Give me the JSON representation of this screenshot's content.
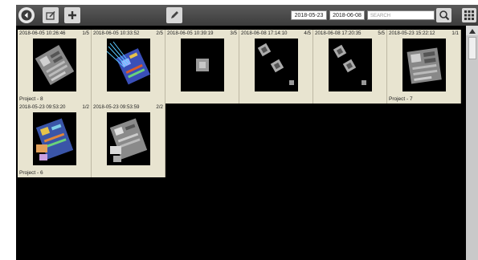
{
  "toolbar": {
    "date_from": "2018-05-23",
    "date_to": "2018-06-08",
    "search_placeholder": "SEARCH"
  },
  "tiles": [
    {
      "timestamp": "2018-06-05 10:26:46",
      "count": "1/5",
      "project": "Project - 8"
    },
    {
      "timestamp": "2018-06-05 10:33:52",
      "count": "2/5",
      "project": ""
    },
    {
      "timestamp": "2018-06-05 10:39:19",
      "count": "3/5",
      "project": ""
    },
    {
      "timestamp": "2018-06-08 17:14:10",
      "count": "4/5",
      "project": ""
    },
    {
      "timestamp": "2018-06-08 17:20:35",
      "count": "5/5",
      "project": ""
    },
    {
      "timestamp": "2018-05-23 15:22:12",
      "count": "1/1",
      "project": "Project - 7"
    },
    {
      "timestamp": "2018-05-23 09:53:20",
      "count": "1/2",
      "project": "Project - 6"
    },
    {
      "timestamp": "2018-05-23 09:53:59",
      "count": "2/2",
      "project": ""
    }
  ]
}
